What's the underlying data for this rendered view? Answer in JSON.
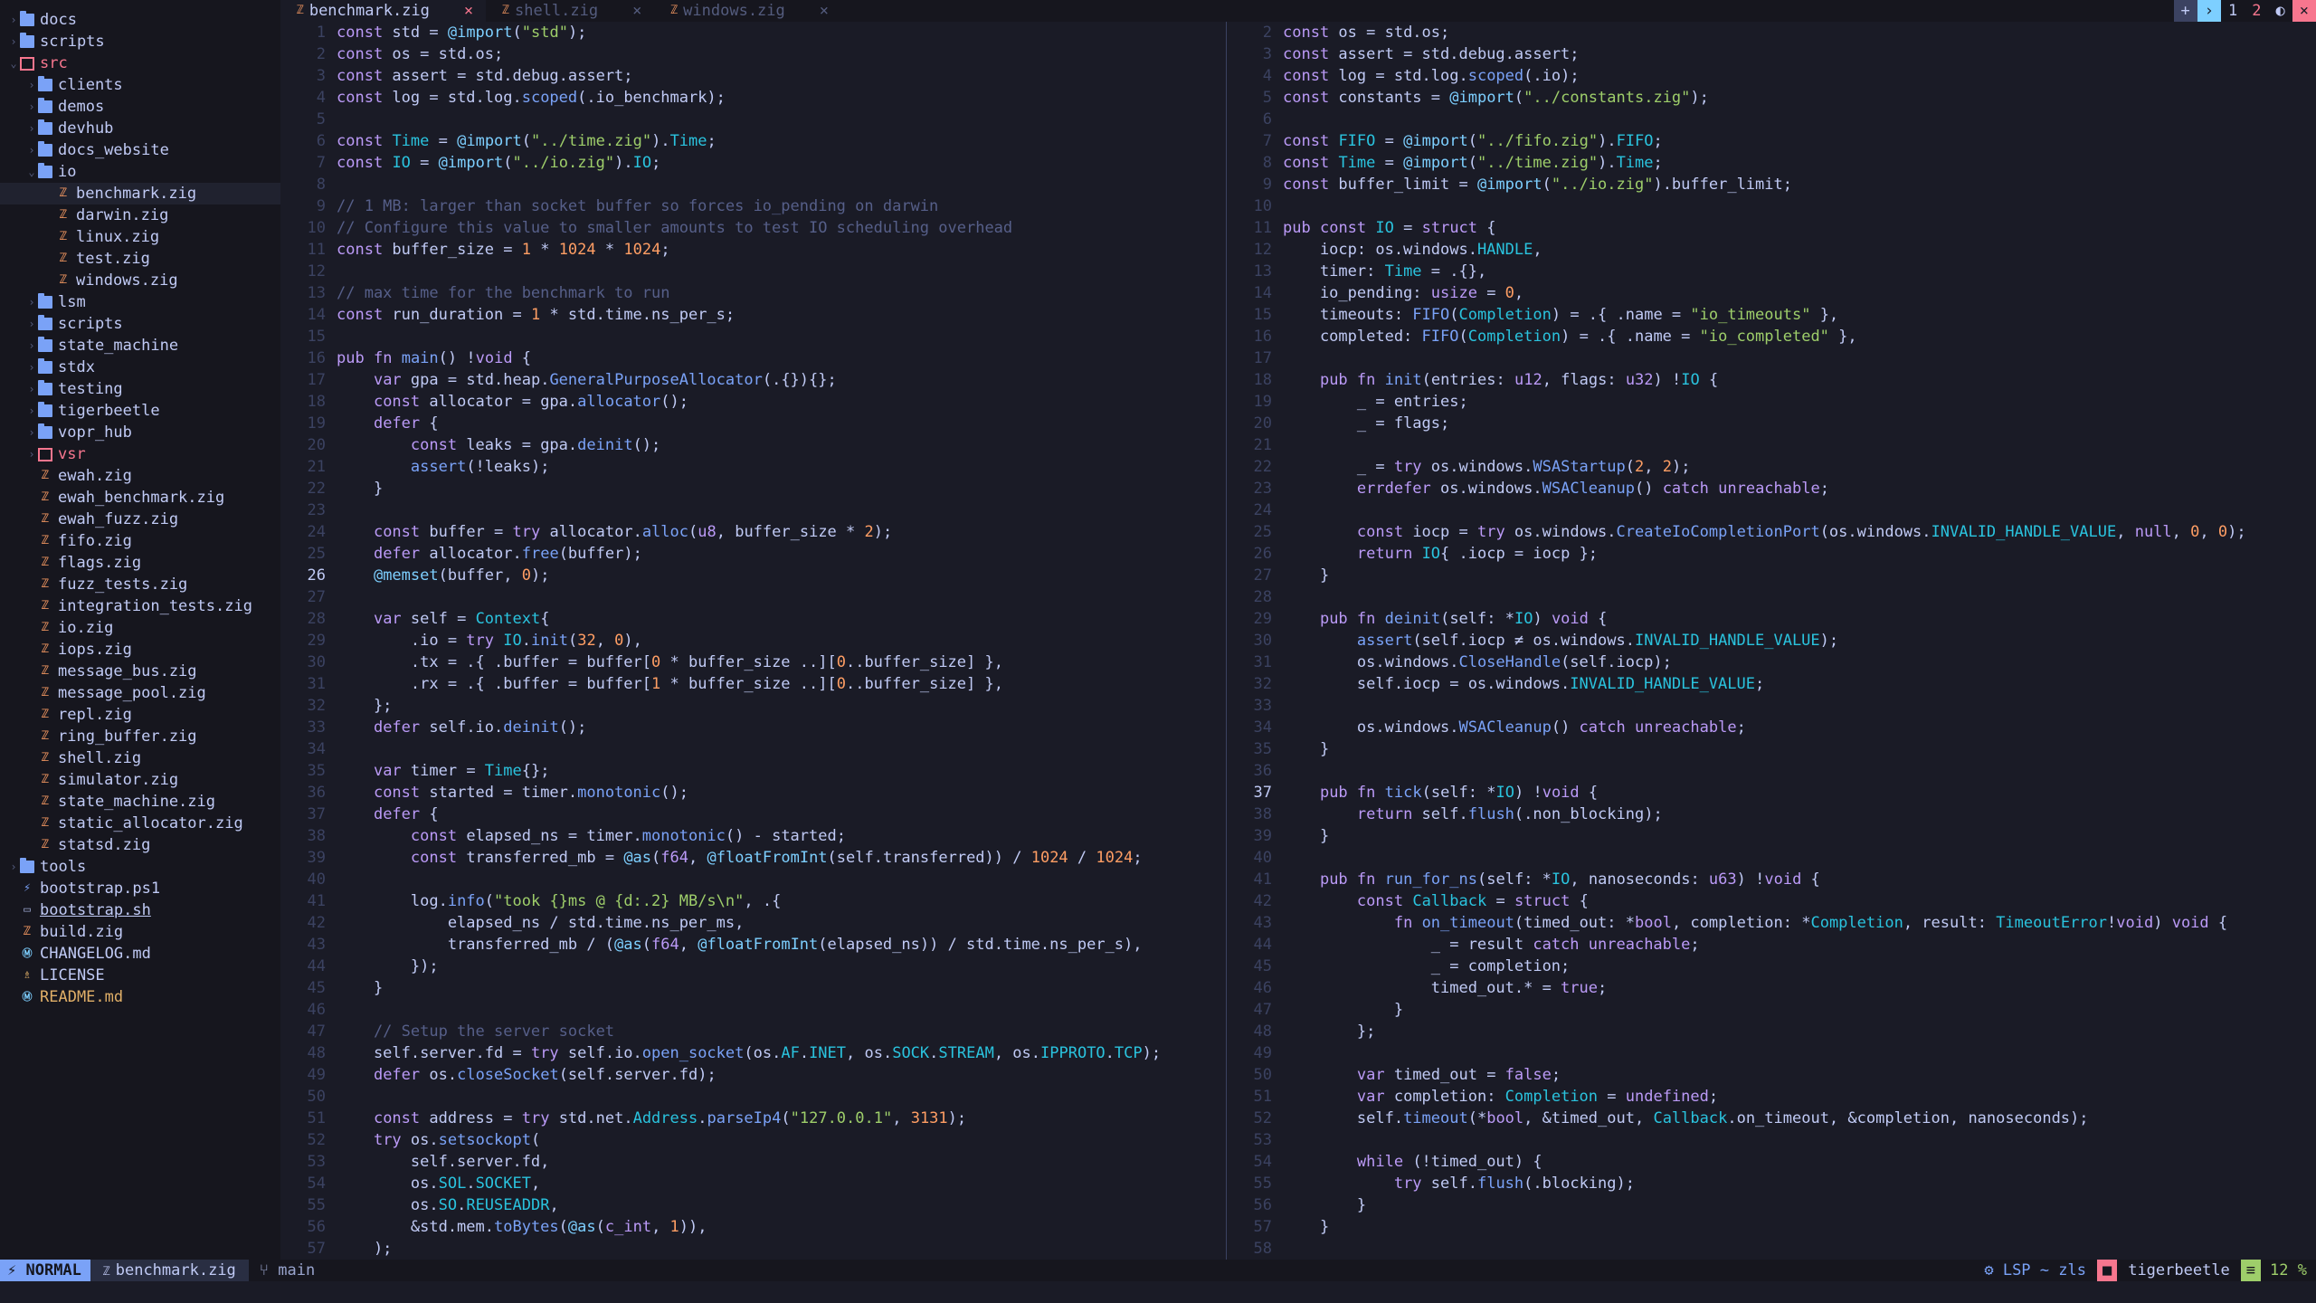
{
  "colors": {
    "bg": "#1a1b26",
    "keyword": "#bb9af7",
    "string": "#9ece6a",
    "number": "#ff9e64",
    "func": "#7aa2f7",
    "builtin": "#7dcfff",
    "comment": "#565f89",
    "type": "#2ac3de",
    "field": "#73daca",
    "accent": "#7aa2f7",
    "error": "#f7768e"
  },
  "tree": [
    {
      "depth": 0,
      "kind": "folder",
      "chev": "›",
      "name": "docs"
    },
    {
      "depth": 0,
      "kind": "folder",
      "chev": "›",
      "name": "scripts"
    },
    {
      "depth": 0,
      "kind": "folder-special",
      "chev": "⌄",
      "name": "src",
      "red": true
    },
    {
      "depth": 1,
      "kind": "folder",
      "chev": "›",
      "name": "clients"
    },
    {
      "depth": 1,
      "kind": "folder",
      "chev": "›",
      "name": "demos"
    },
    {
      "depth": 1,
      "kind": "folder",
      "chev": "›",
      "name": "devhub"
    },
    {
      "depth": 1,
      "kind": "folder",
      "chev": "›",
      "name": "docs_website"
    },
    {
      "depth": 1,
      "kind": "folder",
      "chev": "⌄",
      "name": "io"
    },
    {
      "depth": 2,
      "kind": "zig",
      "name": "benchmark.zig",
      "selected": true
    },
    {
      "depth": 2,
      "kind": "zig",
      "name": "darwin.zig"
    },
    {
      "depth": 2,
      "kind": "zig",
      "name": "linux.zig"
    },
    {
      "depth": 2,
      "kind": "zig",
      "name": "test.zig"
    },
    {
      "depth": 2,
      "kind": "zig",
      "name": "windows.zig"
    },
    {
      "depth": 1,
      "kind": "folder",
      "chev": "›",
      "name": "lsm"
    },
    {
      "depth": 1,
      "kind": "folder",
      "chev": "›",
      "name": "scripts"
    },
    {
      "depth": 1,
      "kind": "folder",
      "chev": "›",
      "name": "state_machine"
    },
    {
      "depth": 1,
      "kind": "folder",
      "chev": "›",
      "name": "stdx"
    },
    {
      "depth": 1,
      "kind": "folder",
      "chev": "›",
      "name": "testing"
    },
    {
      "depth": 1,
      "kind": "folder",
      "chev": "›",
      "name": "tigerbeetle"
    },
    {
      "depth": 1,
      "kind": "folder",
      "chev": "›",
      "name": "vopr_hub"
    },
    {
      "depth": 1,
      "kind": "folder-special",
      "chev": "›",
      "name": "vsr",
      "red": true
    },
    {
      "depth": 1,
      "kind": "zig",
      "name": "ewah.zig"
    },
    {
      "depth": 1,
      "kind": "zig",
      "name": "ewah_benchmark.zig"
    },
    {
      "depth": 1,
      "kind": "zig",
      "name": "ewah_fuzz.zig"
    },
    {
      "depth": 1,
      "kind": "zig",
      "name": "fifo.zig"
    },
    {
      "depth": 1,
      "kind": "zig",
      "name": "flags.zig"
    },
    {
      "depth": 1,
      "kind": "zig",
      "name": "fuzz_tests.zig"
    },
    {
      "depth": 1,
      "kind": "zig",
      "name": "integration_tests.zig"
    },
    {
      "depth": 1,
      "kind": "zig",
      "name": "io.zig"
    },
    {
      "depth": 1,
      "kind": "zig",
      "name": "iops.zig"
    },
    {
      "depth": 1,
      "kind": "zig",
      "name": "message_bus.zig"
    },
    {
      "depth": 1,
      "kind": "zig",
      "name": "message_pool.zig"
    },
    {
      "depth": 1,
      "kind": "zig",
      "name": "repl.zig"
    },
    {
      "depth": 1,
      "kind": "zig",
      "name": "ring_buffer.zig"
    },
    {
      "depth": 1,
      "kind": "zig",
      "name": "shell.zig"
    },
    {
      "depth": 1,
      "kind": "zig",
      "name": "simulator.zig"
    },
    {
      "depth": 1,
      "kind": "zig",
      "name": "state_machine.zig"
    },
    {
      "depth": 1,
      "kind": "zig",
      "name": "static_allocator.zig"
    },
    {
      "depth": 1,
      "kind": "zig",
      "name": "statsd.zig"
    },
    {
      "depth": 0,
      "kind": "folder",
      "chev": "›",
      "name": "tools"
    },
    {
      "depth": 0,
      "kind": "ps",
      "name": "bootstrap.ps1"
    },
    {
      "depth": 0,
      "kind": "sh",
      "name": "bootstrap.sh",
      "underline": true
    },
    {
      "depth": 0,
      "kind": "zig",
      "name": "build.zig"
    },
    {
      "depth": 0,
      "kind": "md",
      "name": "CHANGELOG.md"
    },
    {
      "depth": 0,
      "kind": "lic",
      "name": "LICENSE"
    },
    {
      "depth": 0,
      "kind": "md",
      "name": "README.md",
      "yellow": true
    }
  ],
  "tabs": [
    {
      "name": "benchmark.zig",
      "active": true,
      "close": "×"
    },
    {
      "name": "shell.zig",
      "active": false,
      "close": "×"
    },
    {
      "name": "windows.zig",
      "active": false,
      "close": "×"
    }
  ],
  "tabbar_right": {
    "plus": "+",
    "arrow": "›",
    "n1": "1",
    "n2": "2",
    "toggle": "◐",
    "close": "×"
  },
  "left_pane": {
    "current_line": 26,
    "lines": [
      {
        "n": 1,
        "t": "const std = @import(\"std\");"
      },
      {
        "n": 2,
        "t": "const os = std.os;"
      },
      {
        "n": 3,
        "t": "const assert = std.debug.assert;"
      },
      {
        "n": 4,
        "t": "const log = std.log.scoped(.io_benchmark);"
      },
      {
        "n": 5,
        "t": ""
      },
      {
        "n": 6,
        "t": "const Time = @import(\"../time.zig\").Time;"
      },
      {
        "n": 7,
        "t": "const IO = @import(\"../io.zig\").IO;"
      },
      {
        "n": 8,
        "t": ""
      },
      {
        "n": 9,
        "t": "// 1 MB: larger than socket buffer so forces io_pending on darwin"
      },
      {
        "n": 10,
        "t": "// Configure this value to smaller amounts to test IO scheduling overhead"
      },
      {
        "n": 11,
        "t": "const buffer_size = 1 * 1024 * 1024;"
      },
      {
        "n": 12,
        "t": ""
      },
      {
        "n": 13,
        "t": "// max time for the benchmark to run"
      },
      {
        "n": 14,
        "t": "const run_duration = 1 * std.time.ns_per_s;"
      },
      {
        "n": 15,
        "t": ""
      },
      {
        "n": 16,
        "t": "pub fn main() !void {"
      },
      {
        "n": 17,
        "t": "    var gpa = std.heap.GeneralPurposeAllocator(.{}){};"
      },
      {
        "n": 18,
        "t": "    const allocator = gpa.allocator();"
      },
      {
        "n": 19,
        "t": "    defer {"
      },
      {
        "n": 20,
        "t": "        const leaks = gpa.deinit();"
      },
      {
        "n": 21,
        "t": "        assert(!leaks);"
      },
      {
        "n": 22,
        "t": "    }"
      },
      {
        "n": 23,
        "t": ""
      },
      {
        "n": 24,
        "t": "    const buffer = try allocator.alloc(u8, buffer_size * 2);"
      },
      {
        "n": 25,
        "t": "    defer allocator.free(buffer);"
      },
      {
        "n": 26,
        "t": "    @memset(buffer, 0);"
      },
      {
        "n": 27,
        "t": ""
      },
      {
        "n": 28,
        "t": "    var self = Context{"
      },
      {
        "n": 29,
        "t": "        .io = try IO.init(32, 0),"
      },
      {
        "n": 30,
        "t": "        .tx = .{ .buffer = buffer[0 * buffer_size ..][0..buffer_size] },"
      },
      {
        "n": 31,
        "t": "        .rx = .{ .buffer = buffer[1 * buffer_size ..][0..buffer_size] },"
      },
      {
        "n": 32,
        "t": "    };"
      },
      {
        "n": 33,
        "t": "    defer self.io.deinit();"
      },
      {
        "n": 34,
        "t": ""
      },
      {
        "n": 35,
        "t": "    var timer = Time{};"
      },
      {
        "n": 36,
        "t": "    const started = timer.monotonic();"
      },
      {
        "n": 37,
        "t": "    defer {"
      },
      {
        "n": 38,
        "t": "        const elapsed_ns = timer.monotonic() - started;"
      },
      {
        "n": 39,
        "t": "        const transferred_mb = @as(f64, @floatFromInt(self.transferred)) / 1024 / 1024;"
      },
      {
        "n": 40,
        "t": ""
      },
      {
        "n": 41,
        "t": "        log.info(\"took {}ms @ {d:.2} MB/s\\n\", .{"
      },
      {
        "n": 42,
        "t": "            elapsed_ns / std.time.ns_per_ms,"
      },
      {
        "n": 43,
        "t": "            transferred_mb / (@as(f64, @floatFromInt(elapsed_ns)) / std.time.ns_per_s),"
      },
      {
        "n": 44,
        "t": "        });"
      },
      {
        "n": 45,
        "t": "    }"
      },
      {
        "n": 46,
        "t": ""
      },
      {
        "n": 47,
        "t": "    // Setup the server socket"
      },
      {
        "n": 48,
        "t": "    self.server.fd = try self.io.open_socket(os.AF.INET, os.SOCK.STREAM, os.IPPROTO.TCP);"
      },
      {
        "n": 49,
        "t": "    defer os.closeSocket(self.server.fd);"
      },
      {
        "n": 50,
        "t": ""
      },
      {
        "n": 51,
        "t": "    const address = try std.net.Address.parseIp4(\"127.0.0.1\", 3131);"
      },
      {
        "n": 52,
        "t": "    try os.setsockopt("
      },
      {
        "n": 53,
        "t": "        self.server.fd,"
      },
      {
        "n": 54,
        "t": "        os.SOL.SOCKET,"
      },
      {
        "n": 55,
        "t": "        os.SO.REUSEADDR,"
      },
      {
        "n": 56,
        "t": "        &std.mem.toBytes(@as(c_int, 1)),"
      },
      {
        "n": 57,
        "t": "    );"
      }
    ]
  },
  "right_pane": {
    "current_line": 37,
    "lines": [
      {
        "n": 2,
        "t": "const os = std.os;"
      },
      {
        "n": 3,
        "t": "const assert = std.debug.assert;"
      },
      {
        "n": 4,
        "t": "const log = std.log.scoped(.io);"
      },
      {
        "n": 5,
        "t": "const constants = @import(\"../constants.zig\");"
      },
      {
        "n": 6,
        "t": ""
      },
      {
        "n": 7,
        "t": "const FIFO = @import(\"../fifo.zig\").FIFO;"
      },
      {
        "n": 8,
        "t": "const Time = @import(\"../time.zig\").Time;"
      },
      {
        "n": 9,
        "t": "const buffer_limit = @import(\"../io.zig\").buffer_limit;"
      },
      {
        "n": 10,
        "t": ""
      },
      {
        "n": 11,
        "t": "pub const IO = struct {"
      },
      {
        "n": 12,
        "t": "    iocp: os.windows.HANDLE,"
      },
      {
        "n": 13,
        "t": "    timer: Time = .{},"
      },
      {
        "n": 14,
        "t": "    io_pending: usize = 0,"
      },
      {
        "n": 15,
        "t": "    timeouts: FIFO(Completion) = .{ .name = \"io_timeouts\" },"
      },
      {
        "n": 16,
        "t": "    completed: FIFO(Completion) = .{ .name = \"io_completed\" },"
      },
      {
        "n": 17,
        "t": ""
      },
      {
        "n": 18,
        "t": "    pub fn init(entries: u12, flags: u32) !IO {"
      },
      {
        "n": 19,
        "t": "        _ = entries;"
      },
      {
        "n": 20,
        "t": "        _ = flags;"
      },
      {
        "n": 21,
        "t": ""
      },
      {
        "n": 22,
        "t": "        _ = try os.windows.WSAStartup(2, 2);"
      },
      {
        "n": 23,
        "t": "        errdefer os.windows.WSACleanup() catch unreachable;"
      },
      {
        "n": 24,
        "t": ""
      },
      {
        "n": 25,
        "t": "        const iocp = try os.windows.CreateIoCompletionPort(os.windows.INVALID_HANDLE_VALUE, null, 0, 0);"
      },
      {
        "n": 26,
        "t": "        return IO{ .iocp = iocp };"
      },
      {
        "n": 27,
        "t": "    }"
      },
      {
        "n": 28,
        "t": ""
      },
      {
        "n": 29,
        "t": "    pub fn deinit(self: *IO) void {"
      },
      {
        "n": 30,
        "t": "        assert(self.iocp ≠ os.windows.INVALID_HANDLE_VALUE);"
      },
      {
        "n": 31,
        "t": "        os.windows.CloseHandle(self.iocp);"
      },
      {
        "n": 32,
        "t": "        self.iocp = os.windows.INVALID_HANDLE_VALUE;"
      },
      {
        "n": 33,
        "t": ""
      },
      {
        "n": 34,
        "t": "        os.windows.WSACleanup() catch unreachable;"
      },
      {
        "n": 35,
        "t": "    }"
      },
      {
        "n": 36,
        "t": ""
      },
      {
        "n": 37,
        "t": "    pub fn tick(self: *IO) !void {"
      },
      {
        "n": 38,
        "t": "        return self.flush(.non_blocking);"
      },
      {
        "n": 39,
        "t": "    }"
      },
      {
        "n": 40,
        "t": ""
      },
      {
        "n": 41,
        "t": "    pub fn run_for_ns(self: *IO, nanoseconds: u63) !void {"
      },
      {
        "n": 42,
        "t": "        const Callback = struct {"
      },
      {
        "n": 43,
        "t": "            fn on_timeout(timed_out: *bool, completion: *Completion, result: TimeoutError!void) void {"
      },
      {
        "n": 44,
        "t": "                _ = result catch unreachable;"
      },
      {
        "n": 45,
        "t": "                _ = completion;"
      },
      {
        "n": 46,
        "t": "                timed_out.* = true;"
      },
      {
        "n": 47,
        "t": "            }"
      },
      {
        "n": 48,
        "t": "        };"
      },
      {
        "n": 49,
        "t": ""
      },
      {
        "n": 50,
        "t": "        var timed_out = false;"
      },
      {
        "n": 51,
        "t": "        var completion: Completion = undefined;"
      },
      {
        "n": 52,
        "t": "        self.timeout(*bool, &timed_out, Callback.on_timeout, &completion, nanoseconds);"
      },
      {
        "n": 53,
        "t": ""
      },
      {
        "n": 54,
        "t": "        while (!timed_out) {"
      },
      {
        "n": 55,
        "t": "            try self.flush(.blocking);"
      },
      {
        "n": 56,
        "t": "        }"
      },
      {
        "n": 57,
        "t": "    }"
      },
      {
        "n": 58,
        "t": ""
      }
    ]
  },
  "statusbar": {
    "mode": "NORMAL",
    "file": "benchmark.zig",
    "branch": "main",
    "lsp": "LSP ~ zls",
    "project": "tigerbeetle",
    "percent": "12 %"
  }
}
